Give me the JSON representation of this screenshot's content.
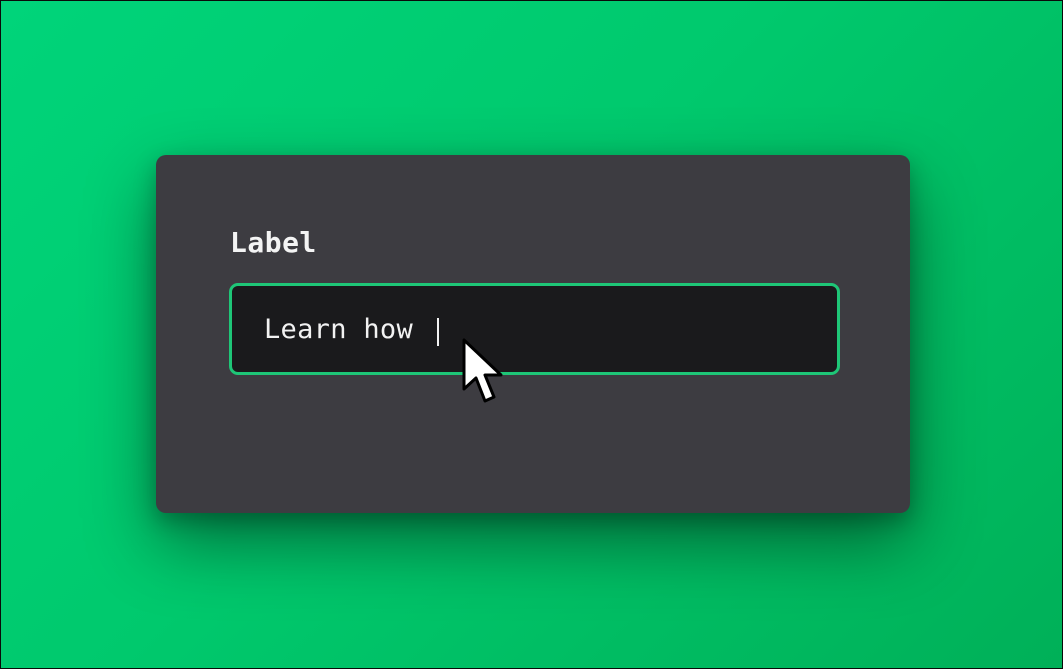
{
  "form": {
    "label": "Label",
    "input_value": "Learn how"
  },
  "colors": {
    "background": "#00c96d",
    "card": "#3d3c41",
    "input_bg": "#1a1a1c",
    "focus_border": "#1ec677",
    "text": "#f2f2f2"
  },
  "icons": {
    "pointer": "mouse-pointer-icon"
  }
}
